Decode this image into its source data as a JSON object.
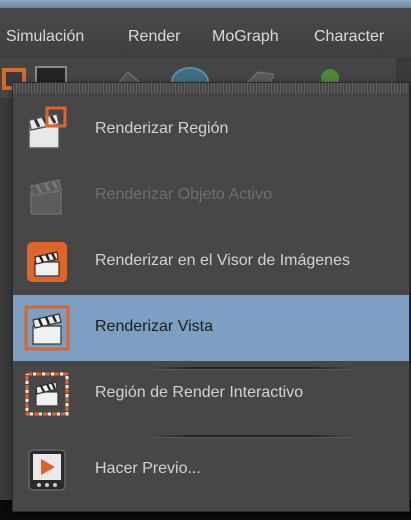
{
  "menubar": {
    "items": [
      "Simulación",
      "Render",
      "MoGraph",
      "Character"
    ]
  },
  "toolbar": {
    "icons": [
      "render-settings-icon",
      "display-icon",
      "view-icon",
      "sphere-icon",
      "camera-icon",
      "light-icon"
    ]
  },
  "dropdown": {
    "items": [
      {
        "label": "Renderizar Región",
        "icon": "render-region-icon",
        "enabled": true,
        "highlighted": false
      },
      {
        "label": "Renderizar Objeto Activo",
        "icon": "render-active-object-icon",
        "enabled": false,
        "highlighted": false
      },
      {
        "label": "Renderizar en el Visor de Imágenes",
        "icon": "render-picture-viewer-icon",
        "enabled": true,
        "highlighted": false
      },
      {
        "label": "Renderizar Vista",
        "icon": "render-view-icon",
        "enabled": true,
        "highlighted": true
      },
      {
        "label": "Región de Render Interactivo",
        "icon": "interactive-render-region-icon",
        "enabled": true,
        "highlighted": false
      },
      {
        "label": "Hacer Previo...",
        "icon": "make-preview-icon",
        "enabled": true,
        "highlighted": false
      }
    ]
  },
  "colors": {
    "highlight": "#7d9fc2",
    "accent_orange": "#e0642a",
    "menu_bg": "#474747",
    "text": "#d2d2d2",
    "disabled_text": "#6e6e6e"
  }
}
